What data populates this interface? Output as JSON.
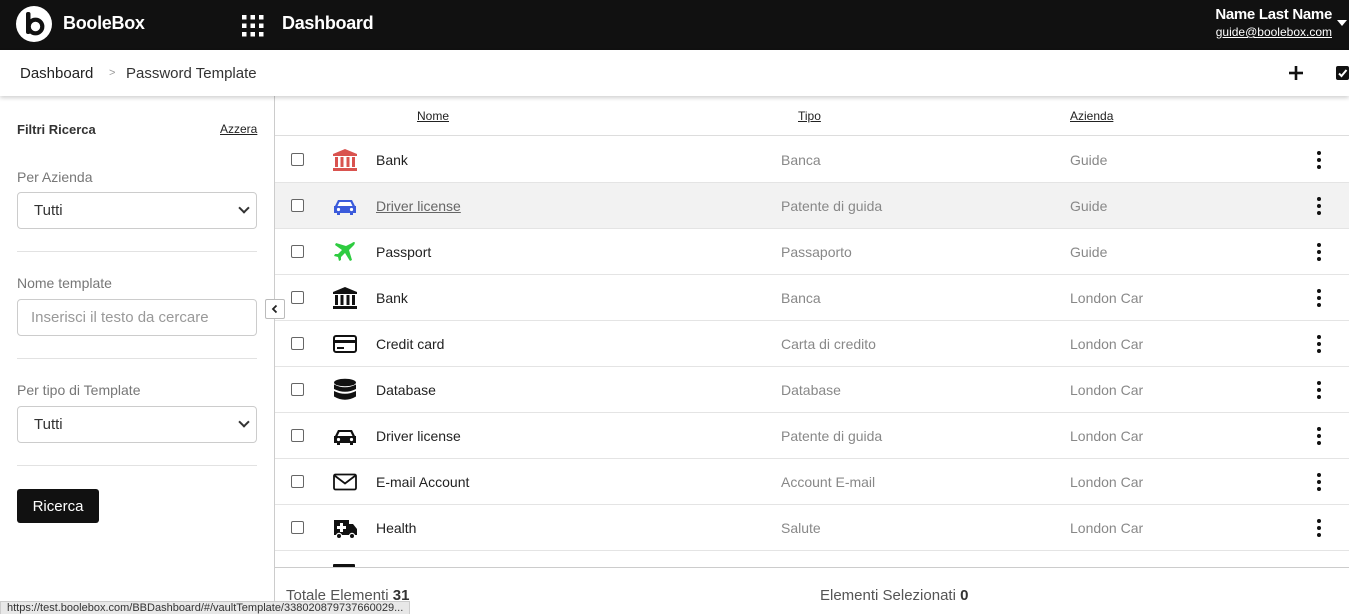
{
  "app": {
    "brand": "BooleBox",
    "title": "Dashboard"
  },
  "user": {
    "name": "Name Last Name",
    "email": "guide@boolebox.com"
  },
  "breadcrumb": {
    "home": "Dashboard",
    "separator": ">",
    "current": "Password Template"
  },
  "filters": {
    "title": "Filtri Ricerca",
    "reset": "Azzera",
    "company_label": "Per Azienda",
    "company_value": "Tutti",
    "name_label": "Nome template",
    "name_placeholder": "Inserisci il testo da cercare",
    "type_label": "Per tipo di Template",
    "type_value": "Tutti",
    "search_button": "Ricerca"
  },
  "table": {
    "headers": {
      "name": "Nome",
      "type": "Tipo",
      "company": "Azienda"
    },
    "rows": [
      {
        "icon": "bank-icon",
        "icon_color": "#d9534f",
        "name": "Bank",
        "type": "Banca",
        "company": "Guide"
      },
      {
        "icon": "car-icon",
        "icon_color": "#3b5bdb",
        "name": "Driver license",
        "type": "Patente di guida",
        "company": "Guide"
      },
      {
        "icon": "airplane-icon",
        "icon_color": "#2ecc40",
        "name": "Passport",
        "type": "Passaporto",
        "company": "Guide"
      },
      {
        "icon": "bank-icon",
        "icon_color": "#111111",
        "name": "Bank",
        "type": "Banca",
        "company": "London Car"
      },
      {
        "icon": "credit-card-icon",
        "icon_color": "#111111",
        "name": "Credit card",
        "type": "Carta di credito",
        "company": "London Car"
      },
      {
        "icon": "database-icon",
        "icon_color": "#111111",
        "name": "Database",
        "type": "Database",
        "company": "London Car"
      },
      {
        "icon": "car-icon",
        "icon_color": "#111111",
        "name": "Driver license",
        "type": "Patente di guida",
        "company": "London Car"
      },
      {
        "icon": "envelope-icon",
        "icon_color": "#111111",
        "name": "E-mail Account",
        "type": "Account E-mail",
        "company": "London Car"
      },
      {
        "icon": "ambulance-icon",
        "icon_color": "#111111",
        "name": "Health",
        "type": "Salute",
        "company": "London Car"
      }
    ]
  },
  "footer": {
    "total_label": "Totale Elementi",
    "total_value": "31",
    "selected_label": "Elementi Selezionati",
    "selected_value": "0"
  },
  "status_url": "https://test.boolebox.com/BBDashboard/#/vaultTemplate/338020879737660029..."
}
